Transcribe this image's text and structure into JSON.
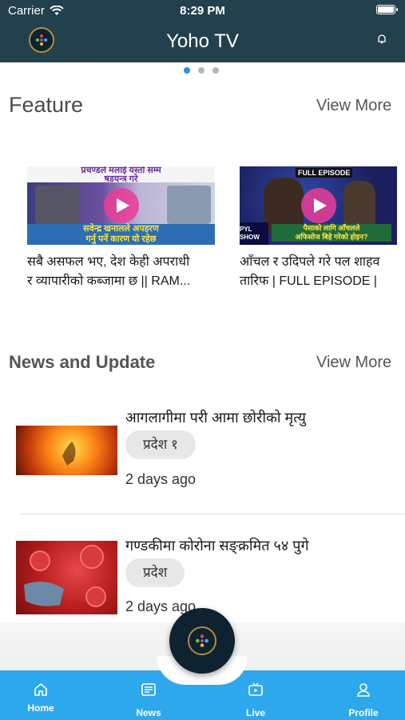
{
  "status_bar": {
    "carrier": "Carrier",
    "time": "8:29 PM"
  },
  "header": {
    "title": "Yoho TV",
    "logo_icon": "yoho-logo-icon",
    "bell_icon": "bell-icon"
  },
  "pager": {
    "count": 3,
    "active": 0
  },
  "feature": {
    "title": "Feature",
    "view_more": "View More",
    "items": [
      {
        "caption_line1": "सबै असफल भए, देश केही अपराधी",
        "caption_line2": "र व्यापारीको कब्जामा छ || RAM...",
        "thumb_text_top": "प्रचण्डले मलाई यस्तो सम्म",
        "thumb_text_top2": "षडयन्त्र गरे",
        "thumb_text_bottom": "सवेन्द्र खनालले अपहरण",
        "thumb_text_bottom2": "गर्नु पर्ने कारण यो रहेछ"
      },
      {
        "caption_line1": "आँचल र उदिपले गरे पल शाहव",
        "caption_line2": "तारिफ | FULL EPISODE |",
        "thumb_text_top": "FULL EPISODE",
        "thumb_text_bottom": "पैसाको लागि आँचलले",
        "thumb_text_bottom2": "अफिसोज बिहे गरेको होइन?",
        "thumb_text_corner": "PYL SHOW"
      }
    ]
  },
  "news": {
    "title": "News and Update",
    "view_more": "View More",
    "items": [
      {
        "title": "आगलागीमा परी आमा छोरीको मृत्यु",
        "badge": "प्रदेश १",
        "time": "2 days ago"
      },
      {
        "title": "गण्डकीमा कोरोना सङ्क्रमित ५४ पुगे",
        "badge": "प्रदेश",
        "time": "2 days ago"
      }
    ]
  },
  "tabbar": {
    "items": [
      {
        "label": "Home",
        "icon": "home-icon"
      },
      {
        "label": "News",
        "icon": "news-icon"
      },
      {
        "label": "Live",
        "icon": "tv-icon"
      },
      {
        "label": "Profile",
        "icon": "profile-icon"
      }
    ]
  },
  "colors": {
    "header": "#23414d",
    "tabbar": "#2ea8ec",
    "accent": "#2f8ed9",
    "play": "#eb3c96"
  }
}
